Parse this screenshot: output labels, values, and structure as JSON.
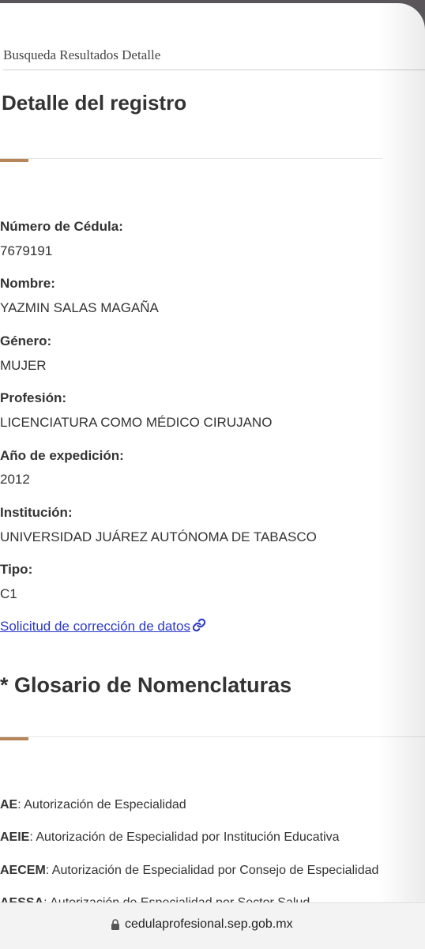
{
  "breadcrumb": "Busqueda Resultados Detalle",
  "page_title": "Detalle del registro",
  "fields": [
    {
      "label": "Número de Cédula:",
      "value": "7679191"
    },
    {
      "label": "Nombre:",
      "value": "YAZMIN SALAS MAGAÑA"
    },
    {
      "label": "Género:",
      "value": "MUJER"
    },
    {
      "label": "Profesión:",
      "value": "LICENCIATURA COMO MÉDICO CIRUJANO"
    },
    {
      "label": "Año de expedición:",
      "value": "2012"
    },
    {
      "label": "Institución:",
      "value": "UNIVERSIDAD JUÁREZ AUTÓNOMA DE TABASCO"
    },
    {
      "label": "Tipo:",
      "value": "C1"
    }
  ],
  "correction_link": "Solicitud de corrección de datos",
  "glossary": {
    "title": "* Glosario de Nomenclaturas",
    "items": [
      {
        "abbr": "AE",
        "text": ": Autorización de Especialidad"
      },
      {
        "abbr": "AEIE",
        "text": ": Autorización de Especialidad por Institución Educativa"
      },
      {
        "abbr": "AECEM",
        "text": ": Autorización de Especialidad por Consejo de Especialidad"
      },
      {
        "abbr": "AESSA",
        "text": ": Autorización de Especialidad por Sector Salud"
      }
    ]
  },
  "url": "cedulaprofesional.sep.gob.mx",
  "colors": {
    "accent": "#b6865a",
    "link": "#2a38c8",
    "text": "#333333"
  },
  "icons": {
    "link": "link-icon",
    "lock": "lock-icon"
  }
}
